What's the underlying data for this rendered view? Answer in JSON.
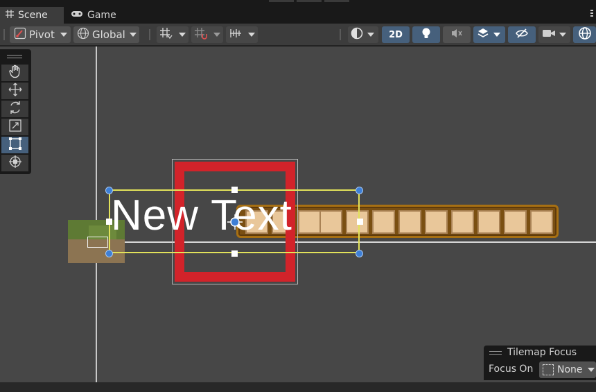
{
  "tabs": [
    {
      "label": "Scene",
      "icon": "grid-icon",
      "active": true
    },
    {
      "label": "Game",
      "icon": "gamepad-icon",
      "active": false
    }
  ],
  "toolbar": {
    "pivot_label": "Pivot",
    "global_label": "Global",
    "mode_2d_label": "2D"
  },
  "scene": {
    "text_object": "New Text",
    "healthbar_slots": 12
  },
  "tilemap_focus": {
    "title": "Tilemap Focus",
    "focus_on_label": "Focus On",
    "focus_on_value": "None"
  },
  "colors": {
    "accent_blue": "#46607c",
    "rect_selection": "#e2e25a",
    "red_frame": "#d2232a"
  }
}
